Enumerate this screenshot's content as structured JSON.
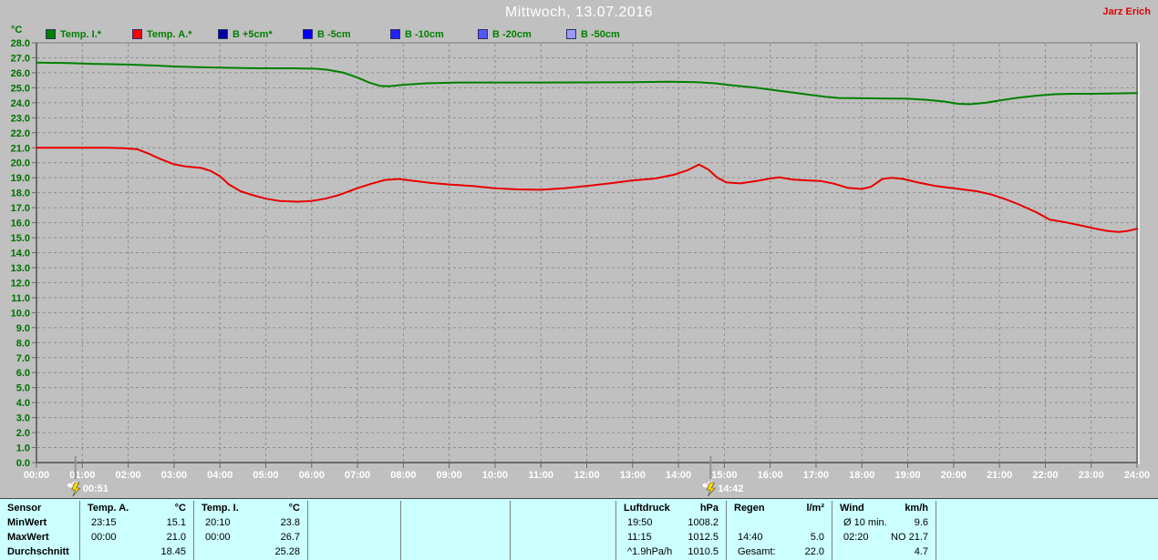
{
  "header": {
    "title": "Mittwoch, 13.07.2016",
    "user": "Jarz Erich"
  },
  "legend": {
    "unit_label": "°C",
    "items": [
      {
        "id": "temp-i",
        "label": "Temp. I.*",
        "color": "#008000"
      },
      {
        "id": "temp-a",
        "label": "Temp. A.*",
        "color": "#ff0000"
      },
      {
        "id": "b-plus5",
        "label": "B +5cm*",
        "color": "#0000a0"
      },
      {
        "id": "b-5",
        "label": "B -5cm",
        "color": "#0000ff"
      },
      {
        "id": "b-10",
        "label": "B -10cm",
        "color": "#2222ff"
      },
      {
        "id": "b-20",
        "label": "B -20cm",
        "color": "#5555ff"
      },
      {
        "id": "b-50",
        "label": "B -50cm",
        "color": "#9999ff"
      }
    ]
  },
  "chart_data": {
    "type": "line",
    "title": "Mittwoch, 13.07.2016",
    "y_unit": "°C",
    "ylim": [
      0,
      28
    ],
    "ytick_step": 1,
    "grid": "dashed",
    "x_tick_labels": [
      "00:00",
      "01:00",
      "02:00",
      "03:00",
      "04:00",
      "05:00",
      "06:00",
      "07:00",
      "08:00",
      "09:00",
      "10:00",
      "11:00",
      "12:00",
      "13:00",
      "14:00",
      "15:00",
      "16:00",
      "17:00",
      "18:00",
      "19:00",
      "20:00",
      "21:00",
      "22:00",
      "23:00",
      "24:00"
    ],
    "series": [
      {
        "name": "Temp. I.",
        "color": "#008000",
        "points": [
          [
            0,
            26.68
          ],
          [
            0.7,
            26.65
          ],
          [
            1.2,
            26.6
          ],
          [
            2,
            26.55
          ],
          [
            2.6,
            26.48
          ],
          [
            3,
            26.42
          ],
          [
            3.5,
            26.38
          ],
          [
            4,
            26.35
          ],
          [
            4.5,
            26.32
          ],
          [
            5,
            26.3
          ],
          [
            5.6,
            26.3
          ],
          [
            6.1,
            26.27
          ],
          [
            6.35,
            26.2
          ],
          [
            6.7,
            26.0
          ],
          [
            7,
            25.68
          ],
          [
            7.25,
            25.35
          ],
          [
            7.5,
            25.12
          ],
          [
            7.7,
            25.1
          ],
          [
            8,
            25.2
          ],
          [
            8.5,
            25.3
          ],
          [
            9.2,
            25.35
          ],
          [
            10,
            25.35
          ],
          [
            11,
            25.35
          ],
          [
            12,
            25.36
          ],
          [
            13,
            25.37
          ],
          [
            13.8,
            25.4
          ],
          [
            14.4,
            25.37
          ],
          [
            14.8,
            25.3
          ],
          [
            15.2,
            25.15
          ],
          [
            15.7,
            25.0
          ],
          [
            16.2,
            24.8
          ],
          [
            16.7,
            24.6
          ],
          [
            17.2,
            24.4
          ],
          [
            17.5,
            24.32
          ],
          [
            18,
            24.3
          ],
          [
            18.6,
            24.28
          ],
          [
            19,
            24.27
          ],
          [
            19.4,
            24.2
          ],
          [
            19.8,
            24.08
          ],
          [
            20.1,
            23.93
          ],
          [
            20.35,
            23.9
          ],
          [
            20.7,
            24.0
          ],
          [
            21,
            24.15
          ],
          [
            21.4,
            24.33
          ],
          [
            21.8,
            24.47
          ],
          [
            22.2,
            24.57
          ],
          [
            22.6,
            24.6
          ],
          [
            23,
            24.6
          ],
          [
            23.5,
            24.62
          ],
          [
            24,
            24.65
          ]
        ]
      },
      {
        "name": "Temp. A.",
        "color": "#e80000",
        "points": [
          [
            0,
            21.0
          ],
          [
            0.5,
            21.0
          ],
          [
            1,
            21.0
          ],
          [
            1.5,
            21.0
          ],
          [
            1.9,
            20.97
          ],
          [
            2.2,
            20.9
          ],
          [
            2.45,
            20.6
          ],
          [
            2.7,
            20.25
          ],
          [
            3,
            19.9
          ],
          [
            3.25,
            19.75
          ],
          [
            3.6,
            19.65
          ],
          [
            3.8,
            19.45
          ],
          [
            4,
            19.1
          ],
          [
            4.2,
            18.55
          ],
          [
            4.45,
            18.1
          ],
          [
            4.7,
            17.85
          ],
          [
            5,
            17.6
          ],
          [
            5.3,
            17.45
          ],
          [
            5.7,
            17.4
          ],
          [
            6,
            17.45
          ],
          [
            6.3,
            17.6
          ],
          [
            6.6,
            17.85
          ],
          [
            7,
            18.3
          ],
          [
            7.3,
            18.6
          ],
          [
            7.6,
            18.85
          ],
          [
            7.9,
            18.92
          ],
          [
            8.2,
            18.8
          ],
          [
            8.6,
            18.65
          ],
          [
            9,
            18.55
          ],
          [
            9.5,
            18.45
          ],
          [
            10,
            18.3
          ],
          [
            10.5,
            18.22
          ],
          [
            11,
            18.2
          ],
          [
            11.5,
            18.3
          ],
          [
            12,
            18.45
          ],
          [
            12.5,
            18.62
          ],
          [
            13,
            18.82
          ],
          [
            13.5,
            18.95
          ],
          [
            13.9,
            19.2
          ],
          [
            14.2,
            19.5
          ],
          [
            14.45,
            19.88
          ],
          [
            14.65,
            19.55
          ],
          [
            14.85,
            19.0
          ],
          [
            15.05,
            18.68
          ],
          [
            15.35,
            18.62
          ],
          [
            15.7,
            18.78
          ],
          [
            16,
            18.95
          ],
          [
            16.2,
            19.02
          ],
          [
            16.5,
            18.88
          ],
          [
            16.8,
            18.82
          ],
          [
            17.1,
            18.78
          ],
          [
            17.4,
            18.6
          ],
          [
            17.7,
            18.32
          ],
          [
            18,
            18.25
          ],
          [
            18.2,
            18.4
          ],
          [
            18.45,
            18.92
          ],
          [
            18.65,
            19.0
          ],
          [
            18.9,
            18.92
          ],
          [
            19.2,
            18.7
          ],
          [
            19.6,
            18.45
          ],
          [
            20,
            18.3
          ],
          [
            20.5,
            18.1
          ],
          [
            20.8,
            17.9
          ],
          [
            21.1,
            17.6
          ],
          [
            21.4,
            17.25
          ],
          [
            21.8,
            16.7
          ],
          [
            22.1,
            16.2
          ],
          [
            22.4,
            16.05
          ],
          [
            22.8,
            15.8
          ],
          [
            23.1,
            15.6
          ],
          [
            23.35,
            15.45
          ],
          [
            23.6,
            15.38
          ],
          [
            23.8,
            15.45
          ],
          [
            24,
            15.6
          ]
        ]
      }
    ],
    "event_markers": [
      {
        "time": "00:51",
        "hour": 0.85,
        "icon": "thunderstorm-icon"
      },
      {
        "time": "14:42",
        "hour": 14.7,
        "icon": "thunderstorm-icon"
      }
    ]
  },
  "stats_table": {
    "row_labels": [
      "Sensor",
      "MinWert",
      "MaxWert",
      "Durchschnitt"
    ],
    "columns": [
      {
        "id": "temp-a",
        "name": "Temp. A.",
        "unit": "°C",
        "min_time": "23:15",
        "min_value": "15.1",
        "max_time": "00:00",
        "max_value": "21.0",
        "avg_label": "",
        "avg_value": "18.45"
      },
      {
        "id": "temp-i",
        "name": "Temp. I.",
        "unit": "°C",
        "min_time": "20:10",
        "min_value": "23.8",
        "max_time": "00:00",
        "max_value": "26.7",
        "avg_label": "",
        "avg_value": "25.28"
      },
      {
        "id": "luftdruck",
        "name": "Luftdruck",
        "unit": "hPa",
        "min_time": "19:50",
        "min_value": "1008.2",
        "max_time": "11:15",
        "max_value": "1012.5",
        "avg_label": "^1.9hPa/h",
        "avg_value": "1010.5"
      },
      {
        "id": "regen",
        "name": "Regen",
        "unit": "l/m²",
        "min_time": "",
        "min_value": "",
        "max_time": "14:40",
        "max_value": "5.0",
        "avg_label": "Gesamt:",
        "avg_value": "22.0"
      },
      {
        "id": "wind",
        "name": "Wind",
        "unit": "km/h",
        "min_time": "Ø 10 min.",
        "min_value": "9.6",
        "max_time": "02:20",
        "max_value": "NO 21.7",
        "avg_label": "",
        "avg_value": "4.7"
      }
    ]
  }
}
